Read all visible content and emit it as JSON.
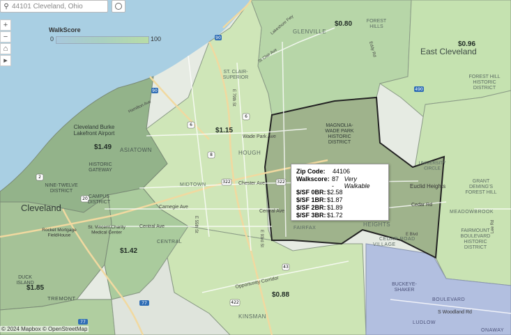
{
  "search": {
    "value": "44101 Cleveland, Ohio"
  },
  "map_controls": {
    "zoom_in": "+",
    "zoom_out": "−",
    "home": "⌂",
    "expand": "▸"
  },
  "legend": {
    "title": "WalkScore",
    "min": "0",
    "max": "100"
  },
  "prices": {
    "p080": "$0.80",
    "p096": "$0.96",
    "p115": "$1.15",
    "p149": "$1.49",
    "p142": "$1.42",
    "p185": "$1.85",
    "p088": "$0.88"
  },
  "places": {
    "east_cleveland": "East Cleveland",
    "cleveland": "Cleveland",
    "glenville": "GLENVILLE",
    "forest_hills": "FOREST\nHILLS",
    "forest_hill_district": "FOREST HILL\nHISTORIC\nDISTRICT",
    "st_clair_superior": "ST. CLAIR-\nSUPERIOR",
    "hough": "HOUGH",
    "asiatown": "ASIATOWN",
    "burke_airport": "Cleveland Burke\nLakefront Airport",
    "historic_gateway": "HISTORIC\nGATEWAY",
    "nine_twelve": "NINE-TWELVE\nDISTRICT",
    "campus_district": "CAMPUS\nDISTRICT",
    "midtown": "MIDTOWN",
    "magnolia": "MAGNOLIA-\nWADE PARK\nHISTORIC\nDISTRICT",
    "fairfax": "FAIRFAX",
    "central": "CENTRAL",
    "kinsman": "KINSMAN",
    "tremont": "TREMONT",
    "duck_island": "DUCK\nISLAND",
    "university_circle": "UNIVERSITY\nCIRCLE",
    "heights": "HEIGHTS",
    "village": "VILLAGE",
    "grant_deming": "GRANT\nDEMING'S\nFOREST HILL",
    "meadowbrook": "MEADOWBROOK",
    "fairmount": "FAIRMOUNT\nBOULEVARD\nHISTORIC\nDISTRICT",
    "buckeye_shaker": "BUCKEYE-\nSHAKER",
    "boulevard": "BOULEVARD",
    "ludlow": "LUDLOW",
    "onaway": "ONAWAY",
    "euclid_heights": "Euclid Heights",
    "cedar_rd": "Cedar Rd",
    "s_woodland": "S Woodland Rd",
    "wade_park": "Wade Park Ave",
    "chester": "Chester Ave",
    "carnegie": "Carnegie Ave",
    "central_ave": "Central Ave",
    "opportunity": "Opportunity Corridor",
    "lakeshore": "Lakeshore Fwy",
    "e55": "E 55th St",
    "e79": "E 79th St",
    "e93": "E 93rd St",
    "stclair_ave": "St Clair Ave",
    "hamilton": "Hamilton Ave",
    "rocket_mortgage": "Rocket Mortgage\nFieldHouse",
    "st_vincent": "St. Vincent Charity\nMedical Center",
    "e_blvd": "E Blvd",
    "eddy": "Eddy Rd",
    "lee_rd": "Lee Rd",
    "cedar_road_village": "CEDAR ROAD"
  },
  "shields": {
    "i90": "90",
    "i490": "490",
    "i77": "77",
    "us6": "6",
    "us322": "322",
    "us20": "20",
    "us2": "2",
    "s422": "422",
    "s43": "43",
    "s8": "8",
    "i90b": "90",
    "i77b": "77",
    "s6": "6",
    "s322b": "322"
  },
  "tooltip": {
    "zip_label": "Zip Code:",
    "zip_value": "44106",
    "walk_label": "Walkscore:",
    "walk_value": "87 -",
    "walk_desc": "Very Walkable",
    "r0_label": "$/SF 0BR:",
    "r0_value": "$2.58",
    "r1_label": "$/SF 1BR:",
    "r1_value": "$1.87",
    "r2_label": "$/SF 2BR:",
    "r2_value": "$1.89",
    "r3_label": "$/SF 3BR:",
    "r3_value": "$1.72"
  },
  "attribution": "© 2024 Mapbox © OpenStreetMap"
}
